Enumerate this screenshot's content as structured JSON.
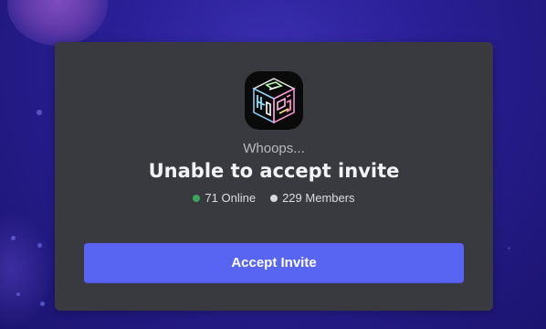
{
  "invite": {
    "subtitle": "Whoops...",
    "title": "Unable to accept invite",
    "online_count": "71 Online",
    "member_count": "229 Members",
    "button_label": "Accept Invite"
  },
  "colors": {
    "online": "#3ba55d",
    "members": "#d8d9de",
    "button": "#5865f2",
    "card": "#393a40"
  },
  "icons": {
    "server": "server-logo-icon",
    "online": "online-status-dot-icon",
    "members": "members-status-dot-icon"
  }
}
